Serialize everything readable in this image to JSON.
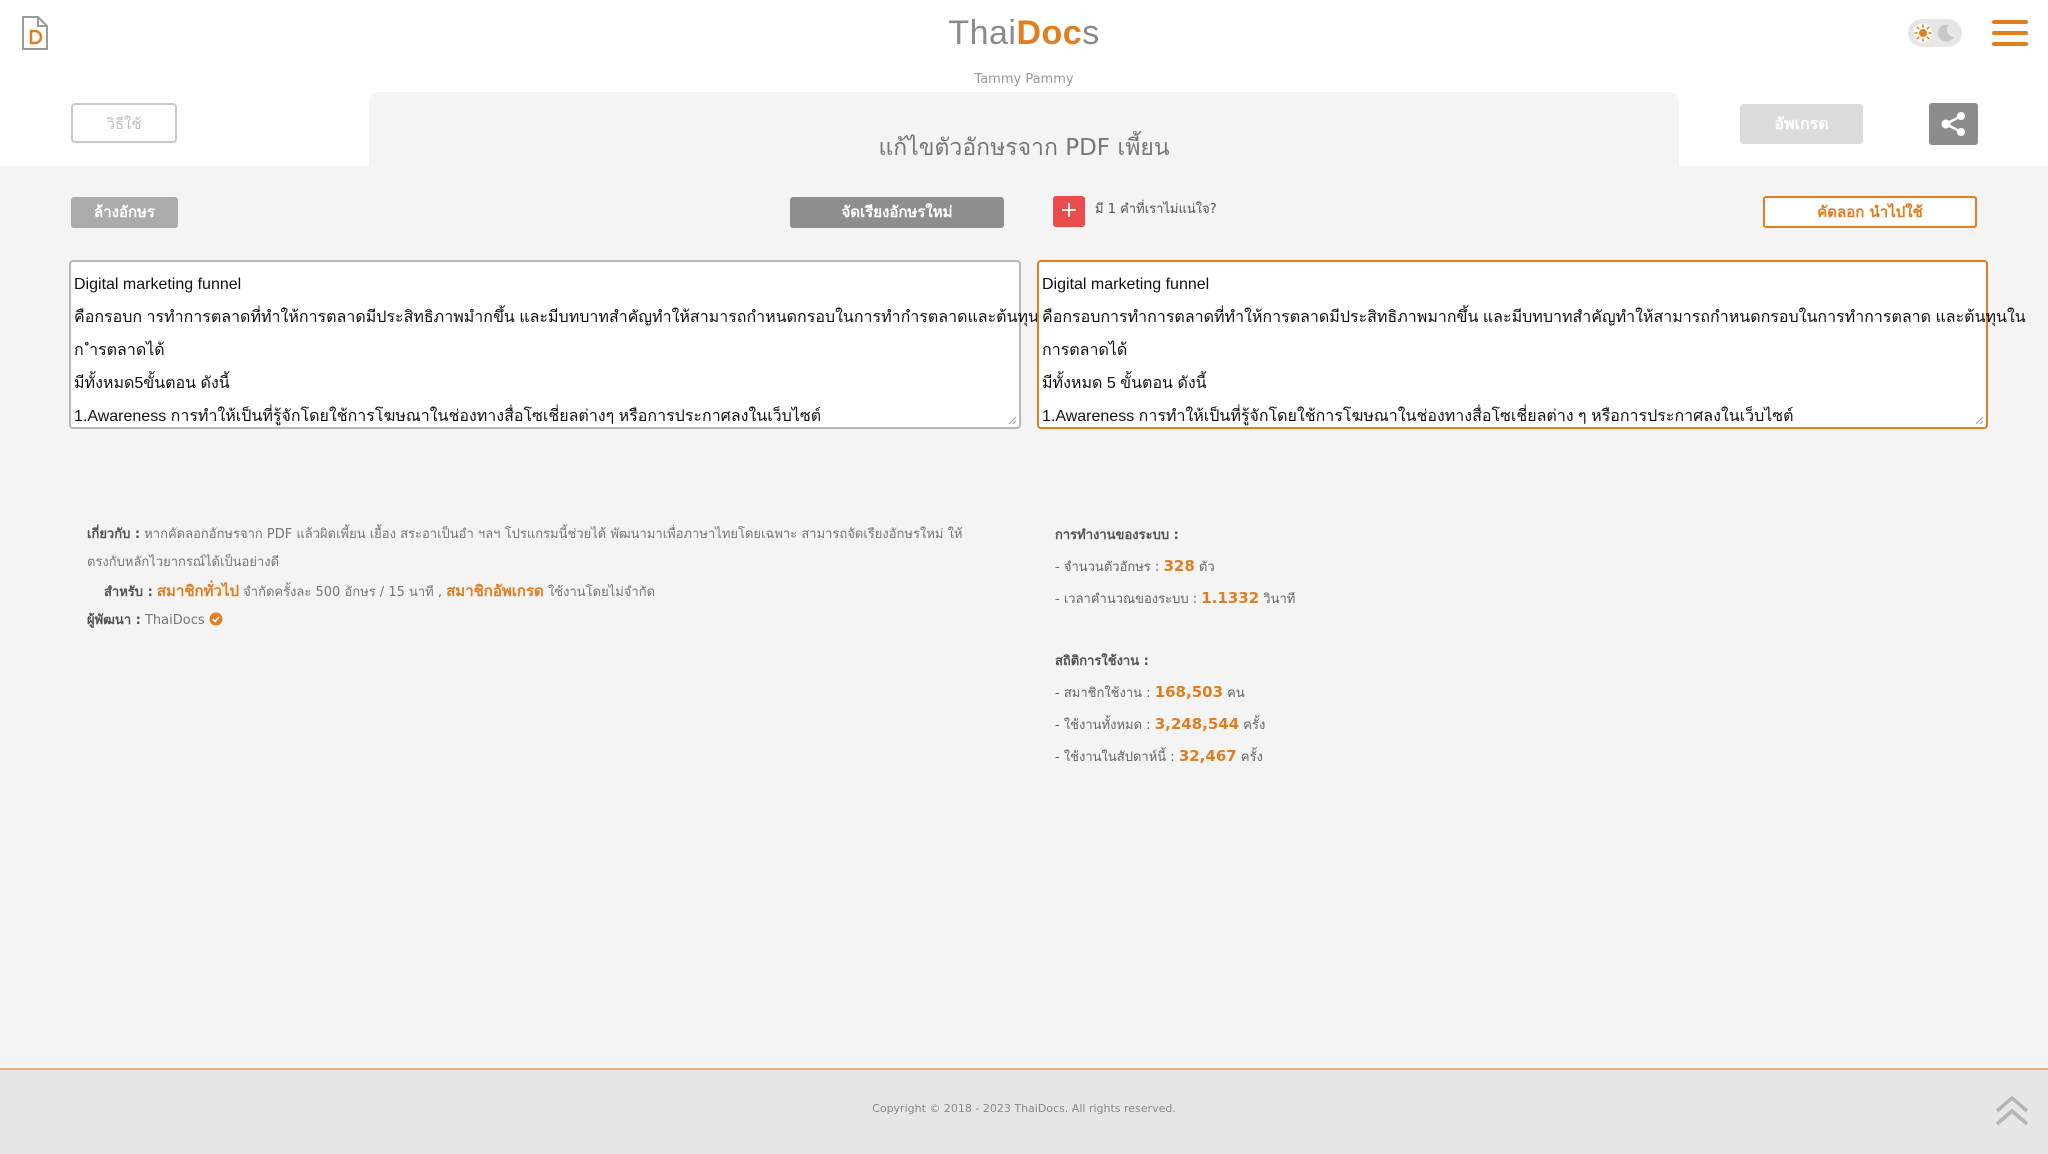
{
  "header": {
    "brand": {
      "part1": "Thai",
      "part2": "Doc",
      "part3": "s"
    },
    "author": "Tammy Pammy",
    "howto_label": "วิธีใช้",
    "page_title": "แก้ไขตัวอักษรจาก PDF เพี้ยน",
    "upgrade_label": "อัพเกรด"
  },
  "toolbar": {
    "clear_label": "ล้างอักษร",
    "rearrange_label": "จัดเรียงอักษรใหม่",
    "plus_label": "+",
    "uncertain_text": "มี 1 คำที่เราไม่แน่ใจ?",
    "copy_label": "คัดลอก นำไปใช้"
  },
  "input_text": {
    "lines": [
      "Digital marketing funnel",
      "คือกรอบก ารทำการตลาดที่ทำให้การตลาดมีประสิทธิภาพมำกขึ้น และมีบทบาทสำคัญทำให้สามารถกำหนดกรอบในการทำกำรตลาดและต้นทุนใน",
      "ก ำรตลาดได้",
      "มีทั้งหมด5ขั้นตอน ดังนี้",
      "1.Awareness การทำให้เป็นที่รู้จักโดยใช้การโฆษณาในช่องทางสื่อโซเชี่ยลต่างๆ หรือการประกาศลงในเว็บไซต์"
    ]
  },
  "output_text": {
    "lines": [
      "Digital marketing funnel",
      "คือกรอบการทำการตลาดที่ทำให้การตลาดมีประสิทธิภาพมากขึ้น และมีบทบาทสำคัญทำให้สามารถกำหนดกรอบในการทำการตลาด และต้นทุนใน",
      "การตลาดได้",
      "มีทั้งหมด 5 ขั้นตอน ดังนี้",
      "1.Awareness การทำให้เป็นที่รู้จักโดยใช้การโฆษณาในช่องทางสื่อโซเชี่ยลต่าง ๆ หรือการประกาศลงในเว็บไซต์"
    ]
  },
  "about": {
    "about_label": "เกี่ยวกับ :",
    "about_text_1": "หากคัดลอกอักษรจาก PDF แล้วผิดเพี้ยน เยื้อง สระอาเป็นอำ ฯลฯ โปรแกรมนี้ช่วยได้ พัฒนามาเพื่อภาษาไทยโดยเฉพาะ สามารถจัดเรียงอักษรใหม่ ให้",
    "about_text_2": "ตรงกับหลักไวยากรณ์ได้เป็นอย่างดี",
    "for_label": "สำหรับ :",
    "general_member": "สมาชิกทั่วไป",
    "general_limit": "จำกัดครั้งละ 500 อักษร / 15 นาที ,",
    "upgrade_member": "สมาชิกอัพเกรด",
    "upgrade_limit": "ใช้งานโดยไม่จำกัด",
    "developer_label": "ผู้พัฒนา :",
    "developer_name": "ThaiDocs"
  },
  "system": {
    "heading": "การทำงานของระบบ :",
    "char_count_label": "- จำนวนตัวอักษร :",
    "char_count": "328",
    "char_unit": "ตัว",
    "time_label": "- เวลาคำนวณของระบบ :",
    "time_value": "1.1332",
    "time_unit": "วินาที"
  },
  "usage": {
    "heading": "สถิติการใช้งาน :",
    "members_label": "- สมาชิกใช้งาน :",
    "members": "168,503",
    "members_unit": "คน",
    "total_label": "- ใช้งานทั้งหมด :",
    "total": "3,248,544",
    "total_unit": "ครั้ง",
    "week_label": "- ใช้งานในสัปดาห์นี้ :",
    "week": "32,467",
    "week_unit": "ครั้ง"
  },
  "footer": {
    "copyright": "Copyright © 2018 - 2023 ThaiDocs. All rights reserved."
  },
  "colors": {
    "accent": "#e07f22",
    "danger": "#e84c4c",
    "background": "#f4f4f4"
  },
  "icons": [
    "document-logo-icon",
    "sun-icon",
    "moon-icon",
    "hamburger-menu-icon",
    "share-icon",
    "verified-check-icon",
    "resize-grip-icon",
    "scroll-top-chevron-icon"
  ]
}
